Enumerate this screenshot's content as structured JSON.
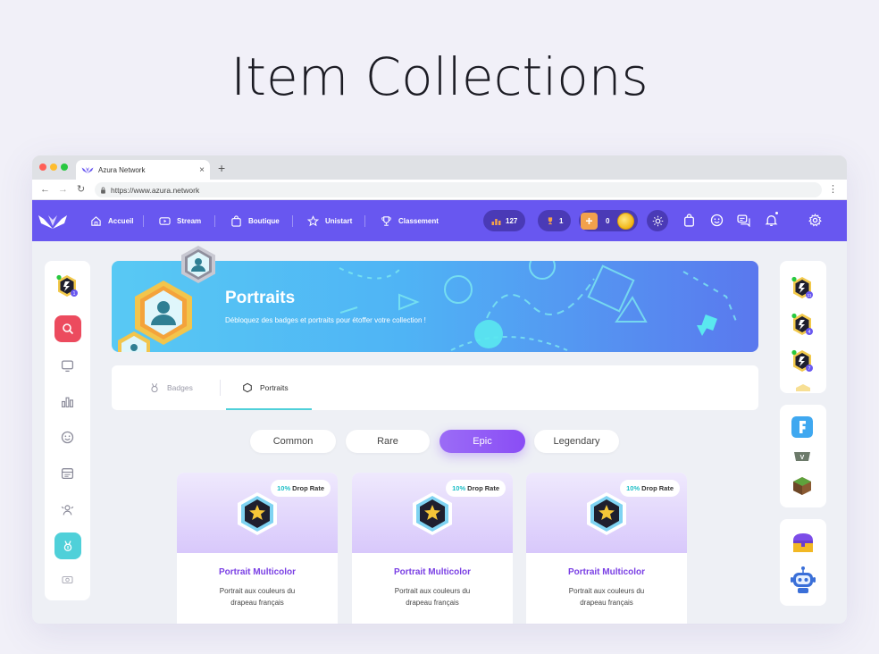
{
  "page": {
    "heading": "Item Collections"
  },
  "browser": {
    "tab_title": "Azura Network",
    "tab_close": "×",
    "new_tab": "+",
    "back": "←",
    "forward": "→",
    "reload": "↻",
    "url": "https://www.azura.network",
    "menu": "⋮"
  },
  "nav": {
    "items": [
      {
        "label": "Accueil",
        "icon": "home-icon"
      },
      {
        "label": "Stream",
        "icon": "play-icon"
      },
      {
        "label": "Boutique",
        "icon": "shopping-bag-icon"
      },
      {
        "label": "Unistart",
        "icon": "star-icon"
      },
      {
        "label": "Classement",
        "icon": "trophy-icon"
      }
    ],
    "stats_value": "127",
    "trophy_value": "1",
    "plus_symbol": "+",
    "coins_value": "0"
  },
  "banner": {
    "title": "Portraits",
    "subtitle": "Débloquez des badges et portraits pour étoffer votre collection !"
  },
  "collection_tabs": [
    {
      "label": "Badges",
      "active": false
    },
    {
      "label": "Portraits",
      "active": true
    }
  ],
  "rarity_filters": [
    {
      "label": "Common",
      "active": false
    },
    {
      "label": "Rare",
      "active": false
    },
    {
      "label": "Epic",
      "active": true
    },
    {
      "label": "Legendary",
      "active": false
    }
  ],
  "cards": [
    {
      "drop_pct": "10%",
      "drop_label": "Drop Rate",
      "title": "Portrait Multicolor",
      "desc_line1": "Portrait aux couleurs du",
      "desc_line2": "drapeau français"
    },
    {
      "drop_pct": "10%",
      "drop_label": "Drop Rate",
      "title": "Portrait Multicolor",
      "desc_line1": "Portrait aux couleurs du",
      "desc_line2": "drapeau français"
    },
    {
      "drop_pct": "10%",
      "drop_label": "Drop Rate",
      "title": "Portrait Multicolor",
      "desc_line1": "Portrait aux couleurs du",
      "desc_line2": "drapeau français"
    }
  ],
  "left_sidebar": {
    "user_level": "1",
    "icons": [
      "search-icon",
      "monitor-icon",
      "bar-chart-icon",
      "smiley-icon",
      "calendar-icon",
      "users-icon",
      "medal-icon",
      "camera-icon"
    ]
  },
  "right_sidebar": {
    "friends": [
      {
        "level": "11"
      },
      {
        "level": "4"
      },
      {
        "level": "7"
      }
    ],
    "games": [
      "fortnite-icon",
      "gta-icon",
      "minecraft-icon"
    ],
    "bottom": [
      "treasure-chest-icon",
      "robot-icon"
    ]
  },
  "colors": {
    "primary": "#6857f0",
    "epic": "#8a4df5",
    "accent_cyan": "#4fd0d9",
    "search_red": "#ec4b5e",
    "card_title": "#7a3fe4"
  }
}
